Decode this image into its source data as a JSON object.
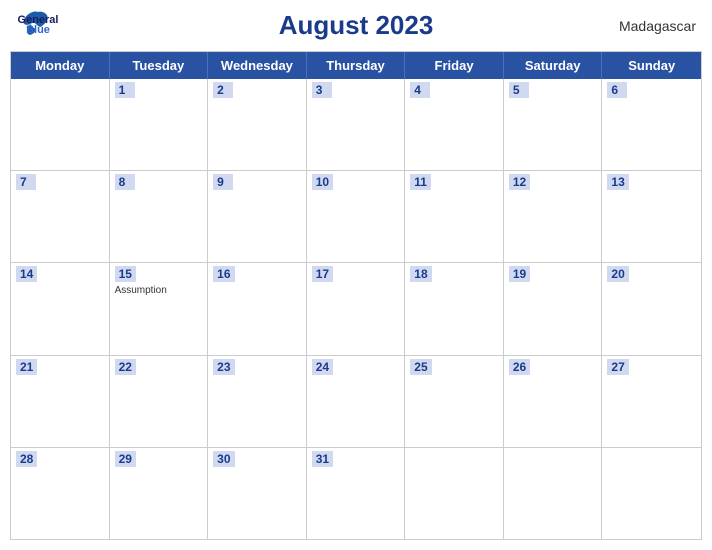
{
  "header": {
    "title": "August 2023",
    "country": "Madagascar",
    "logo": {
      "general": "General",
      "blue": "Blue"
    }
  },
  "calendar": {
    "dayHeaders": [
      "Monday",
      "Tuesday",
      "Wednesday",
      "Thursday",
      "Friday",
      "Saturday",
      "Sunday"
    ],
    "weeks": [
      [
        {
          "date": "",
          "holiday": ""
        },
        {
          "date": "1",
          "holiday": ""
        },
        {
          "date": "2",
          "holiday": ""
        },
        {
          "date": "3",
          "holiday": ""
        },
        {
          "date": "4",
          "holiday": ""
        },
        {
          "date": "5",
          "holiday": ""
        },
        {
          "date": "6",
          "holiday": ""
        }
      ],
      [
        {
          "date": "7",
          "holiday": ""
        },
        {
          "date": "8",
          "holiday": ""
        },
        {
          "date": "9",
          "holiday": ""
        },
        {
          "date": "10",
          "holiday": ""
        },
        {
          "date": "11",
          "holiday": ""
        },
        {
          "date": "12",
          "holiday": ""
        },
        {
          "date": "13",
          "holiday": ""
        }
      ],
      [
        {
          "date": "14",
          "holiday": ""
        },
        {
          "date": "15",
          "holiday": "Assumption"
        },
        {
          "date": "16",
          "holiday": ""
        },
        {
          "date": "17",
          "holiday": ""
        },
        {
          "date": "18",
          "holiday": ""
        },
        {
          "date": "19",
          "holiday": ""
        },
        {
          "date": "20",
          "holiday": ""
        }
      ],
      [
        {
          "date": "21",
          "holiday": ""
        },
        {
          "date": "22",
          "holiday": ""
        },
        {
          "date": "23",
          "holiday": ""
        },
        {
          "date": "24",
          "holiday": ""
        },
        {
          "date": "25",
          "holiday": ""
        },
        {
          "date": "26",
          "holiday": ""
        },
        {
          "date": "27",
          "holiday": ""
        }
      ],
      [
        {
          "date": "28",
          "holiday": ""
        },
        {
          "date": "29",
          "holiday": ""
        },
        {
          "date": "30",
          "holiday": ""
        },
        {
          "date": "31",
          "holiday": ""
        },
        {
          "date": "",
          "holiday": ""
        },
        {
          "date": "",
          "holiday": ""
        },
        {
          "date": "",
          "holiday": ""
        }
      ]
    ]
  }
}
